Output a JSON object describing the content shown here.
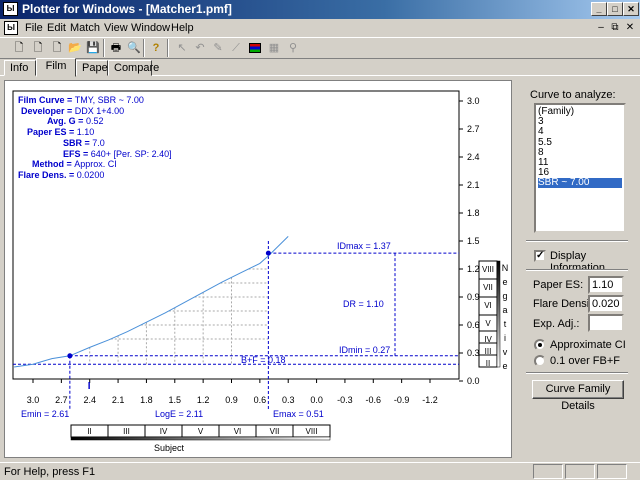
{
  "window": {
    "title": "Plotter for Windows - [Matcher1.pmf]",
    "app_icon": "Ы"
  },
  "menu": [
    "File",
    "Edit",
    "Match",
    "View",
    "Window",
    "Help"
  ],
  "tabs": [
    "Info",
    "Film",
    "Paper",
    "Compare"
  ],
  "active_tab": "Film",
  "info": {
    "film_curve_label": "Film Curve =",
    "film_curve": "TMY, SBR ~ 7.00",
    "developer_label": "Developer =",
    "developer": "DDX 1+4.00",
    "avg_g_label": "Avg. G =",
    "avg_g": "0.52",
    "paper_es_label": "Paper ES =",
    "paper_es": "1.10",
    "sbr_label": "SBR =",
    "sbr": "7.0",
    "efs_label": "EFS =",
    "efs": "640+ [Per. SP: 2.40]",
    "method_label": "Method =",
    "method": "Approx. CI",
    "flare_label": "Flare Dens. =",
    "flare": "0.0200"
  },
  "chart_data": {
    "type": "line",
    "x_ticks": [
      "3.0",
      "2.7",
      "2.4",
      "2.1",
      "1.8",
      "1.5",
      "1.2",
      "0.9",
      "0.6",
      "0.3",
      "0.0",
      "-0.3",
      "-0.6",
      "-0.9",
      "-1.2"
    ],
    "y_ticks": [
      "3.0",
      "2.7",
      "2.4",
      "2.1",
      "1.8",
      "1.5",
      "1.2",
      "0.9",
      "0.6",
      "0.3",
      "0.0"
    ],
    "xlim": [
      3.3,
      -1.5
    ],
    "ylim": [
      -0.1,
      3.1
    ],
    "curve_x": [
      3.2,
      3.0,
      2.9,
      2.8,
      2.61,
      2.4,
      2.2,
      2.0,
      1.8,
      1.6,
      1.4,
      1.2,
      1.0,
      0.8,
      0.6,
      0.5,
      0.3
    ],
    "curve_y": [
      0.15,
      0.18,
      0.21,
      0.24,
      0.27,
      0.36,
      0.44,
      0.53,
      0.63,
      0.73,
      0.84,
      0.95,
      1.06,
      1.16,
      1.26,
      1.35,
      1.55
    ],
    "idmax": {
      "label": "IDmax = 1.37",
      "y": 1.37
    },
    "idmin": {
      "label": "IDmin = 0.27",
      "y": 0.27
    },
    "bf": {
      "label": "B+F = 0.18",
      "y": 0.18
    },
    "dr": {
      "label": "DR = 1.10"
    },
    "emin": {
      "label": "Emin = 2.61",
      "x": 2.61
    },
    "emax": {
      "label": "Emax = 0.51",
      "x": 0.51
    },
    "loge": {
      "label": "LogE = 2.11"
    },
    "subject_label": "Subject",
    "negative_label": [
      "N",
      "e",
      "g",
      "a",
      "t",
      "i",
      "v",
      "e"
    ],
    "zones_subject": [
      "II",
      "III",
      "IV",
      "V",
      "VI",
      "VII",
      "VIII"
    ],
    "zones_negative": [
      "VIII",
      "VII",
      "VI",
      "V",
      "IV",
      "III",
      "II"
    ],
    "curve_color": "#4a90d9",
    "annot_color": "#0000cc"
  },
  "right_panel": {
    "curve_label": "Curve to analyze:",
    "curves": [
      "(Family)",
      "3",
      "4",
      "5.5",
      "8",
      "11",
      "16",
      "SBR ~ 7.00"
    ],
    "selected_curve": "SBR ~ 7.00",
    "display_info_label": "Display Information",
    "display_info_checked": true,
    "paper_es_label": "Paper ES:",
    "paper_es_value": "1.10",
    "flare_label": "Flare Density:",
    "flare_value": "0.0200",
    "exp_adj_label": "Exp. Adj.:",
    "exp_adj_value": "",
    "radio1": "Approximate CI",
    "radio2": "0.1 over FB+F",
    "radio_selected": "Approximate CI",
    "details_button": "Curve Family Details"
  },
  "status": "For Help, press F1",
  "colors": {
    "titlebar": "#0a246a",
    "selection": "#316ac5"
  }
}
